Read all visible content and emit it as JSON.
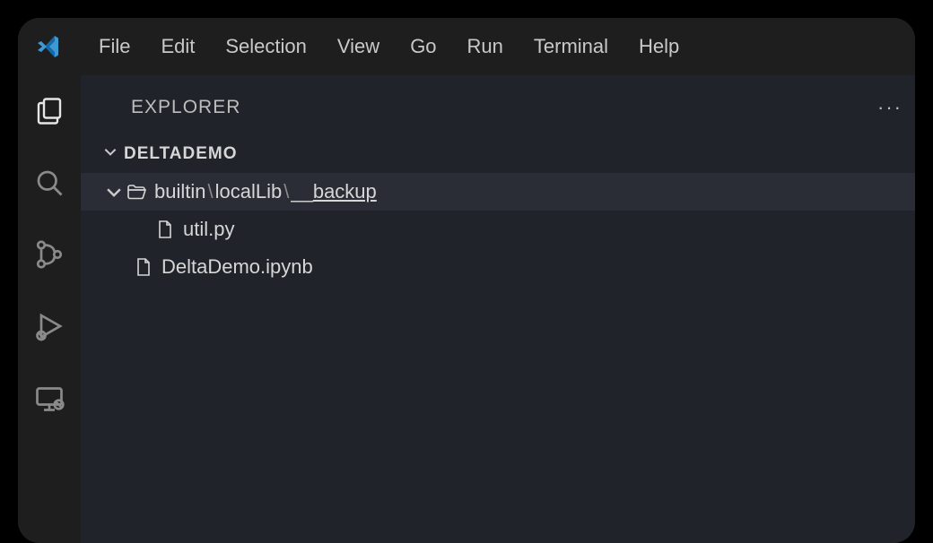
{
  "menu": {
    "file": "File",
    "edit": "Edit",
    "selection": "Selection",
    "view": "View",
    "go": "Go",
    "run": "Run",
    "terminal": "Terminal",
    "help": "Help"
  },
  "sidebar": {
    "title": "EXPLORER",
    "more": "···"
  },
  "workspace": {
    "name": "DELTADEMO"
  },
  "tree": {
    "folder": {
      "seg1": "builtin",
      "seg2": "localLib",
      "seg3pre": "__",
      "seg3main": "backup",
      "sep": "\\"
    },
    "file1": "util.py",
    "file2": "DeltaDemo.ipynb"
  }
}
